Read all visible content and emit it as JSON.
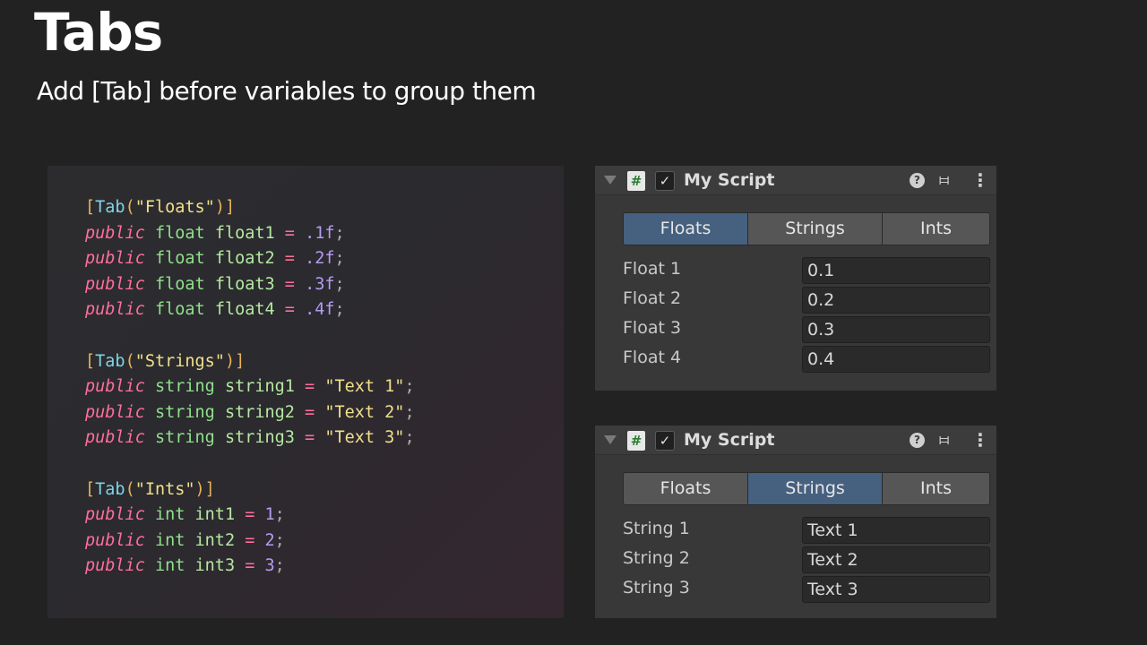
{
  "title": "Tabs",
  "subtitle": "Add [Tab] before variables to group them",
  "code": {
    "blocks": [
      {
        "attr_open": "[",
        "attr_name": "Tab",
        "attr_paren_open": "(",
        "attr_str": "\"Floats\"",
        "attr_close": ")]",
        "lines": [
          {
            "kw": "public",
            "type": "float",
            "name": "float1",
            "op": "=",
            "val": ".1f",
            "end": ";"
          },
          {
            "kw": "public",
            "type": "float",
            "name": "float2",
            "op": "=",
            "val": ".2f",
            "end": ";"
          },
          {
            "kw": "public",
            "type": "float",
            "name": "float3",
            "op": "=",
            "val": ".3f",
            "end": ";"
          },
          {
            "kw": "public",
            "type": "float",
            "name": "float4",
            "op": "=",
            "val": ".4f",
            "end": ";"
          }
        ]
      },
      {
        "attr_open": "[",
        "attr_name": "Tab",
        "attr_paren_open": "(",
        "attr_str": "\"Strings\"",
        "attr_close": ")]",
        "lines": [
          {
            "kw": "public",
            "type": "string",
            "name": "string1",
            "op": "=",
            "val": "\"Text 1\"",
            "end": ";"
          },
          {
            "kw": "public",
            "type": "string",
            "name": "string2",
            "op": "=",
            "val": "\"Text 2\"",
            "end": ";"
          },
          {
            "kw": "public",
            "type": "string",
            "name": "string3",
            "op": "=",
            "val": "\"Text 3\"",
            "end": ";"
          }
        ]
      },
      {
        "attr_open": "[",
        "attr_name": "Tab",
        "attr_paren_open": "(",
        "attr_str": "\"Ints\"",
        "attr_close": ")]",
        "lines": [
          {
            "kw": "public",
            "type": "int",
            "name": "int1",
            "op": "=",
            "val": "1",
            "end": ";"
          },
          {
            "kw": "public",
            "type": "int",
            "name": "int2",
            "op": "=",
            "val": "2",
            "end": ";"
          },
          {
            "kw": "public",
            "type": "int",
            "name": "int3",
            "op": "=",
            "val": "3",
            "end": ";"
          }
        ]
      }
    ]
  },
  "inspectors": [
    {
      "script_icon": "#",
      "checkbox": "✓",
      "script_name": "My Script",
      "help_icon": "?",
      "tabs": [
        "Floats",
        "Strings",
        "Ints"
      ],
      "active_tab": "Floats",
      "rows": [
        {
          "label": "Float 1",
          "value": "0.1"
        },
        {
          "label": "Float 2",
          "value": "0.2"
        },
        {
          "label": "Float 3",
          "value": "0.3"
        },
        {
          "label": "Float 4",
          "value": "0.4"
        }
      ]
    },
    {
      "script_icon": "#",
      "checkbox": "✓",
      "script_name": "My Script",
      "help_icon": "?",
      "tabs": [
        "Floats",
        "Strings",
        "Ints"
      ],
      "active_tab": "Strings",
      "rows": [
        {
          "label": "String 1",
          "value": "Text 1"
        },
        {
          "label": "String 2",
          "value": "Text 2"
        },
        {
          "label": "String 3",
          "value": "Text 3"
        }
      ]
    }
  ],
  "colors": {
    "background": "#222222",
    "active_tab": "#46607f",
    "tab": "#565656",
    "keyword": "#ff6f9a",
    "type": "#8fe08a",
    "number": "#b69bf2",
    "string": "#f0e08a"
  }
}
